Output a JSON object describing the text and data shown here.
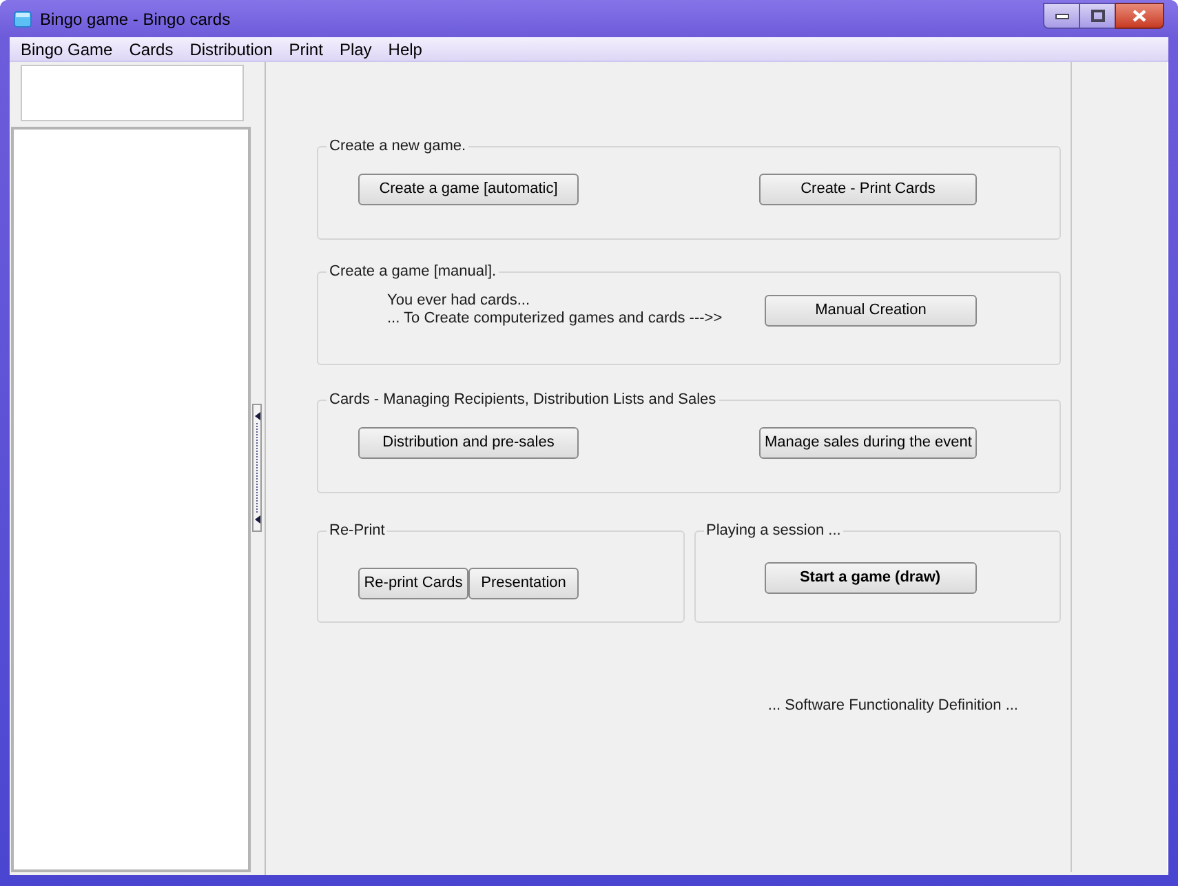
{
  "window": {
    "title": "Bingo game - Bingo cards"
  },
  "menu": [
    {
      "label": "Bingo Game"
    },
    {
      "label": "Cards"
    },
    {
      "label": "Distribution"
    },
    {
      "label": "Print"
    },
    {
      "label": "Play"
    },
    {
      "label": "Help"
    }
  ],
  "groups": [
    {
      "kind": "two_buttons",
      "title": "Create a new game.",
      "buttons": [
        {
          "label": "Create a game [automatic]",
          "default": false
        },
        {
          "label": "Create - Print Cards",
          "default": false
        }
      ]
    },
    {
      "kind": "text_and_button",
      "title": "Create a game [manual].",
      "lines": [
        "You ever had cards...",
        "... To Create computerized games and cards --->>"
      ],
      "buttons": [
        {
          "label": "Manual Creation",
          "default": false
        }
      ]
    },
    {
      "kind": "two_buttons",
      "title": "Cards - Managing Recipients, Distribution Lists and Sales",
      "buttons": [
        {
          "label": "Distribution and pre-sales",
          "default": false
        },
        {
          "label": "Manage sales during the event",
          "default": false
        }
      ]
    }
  ],
  "bottom_groups": [
    {
      "kind": "button_strip",
      "title": "Re-Print",
      "buttons": [
        {
          "label": "Re-print Cards",
          "default": false
        },
        {
          "label": "Presentation",
          "default": false
        }
      ]
    },
    {
      "kind": "single_button",
      "title": "Playing a session ...",
      "buttons": [
        {
          "label": "Start a game (draw)",
          "default": true
        }
      ]
    }
  ],
  "footer": "... Software Functionality Definition ..."
}
